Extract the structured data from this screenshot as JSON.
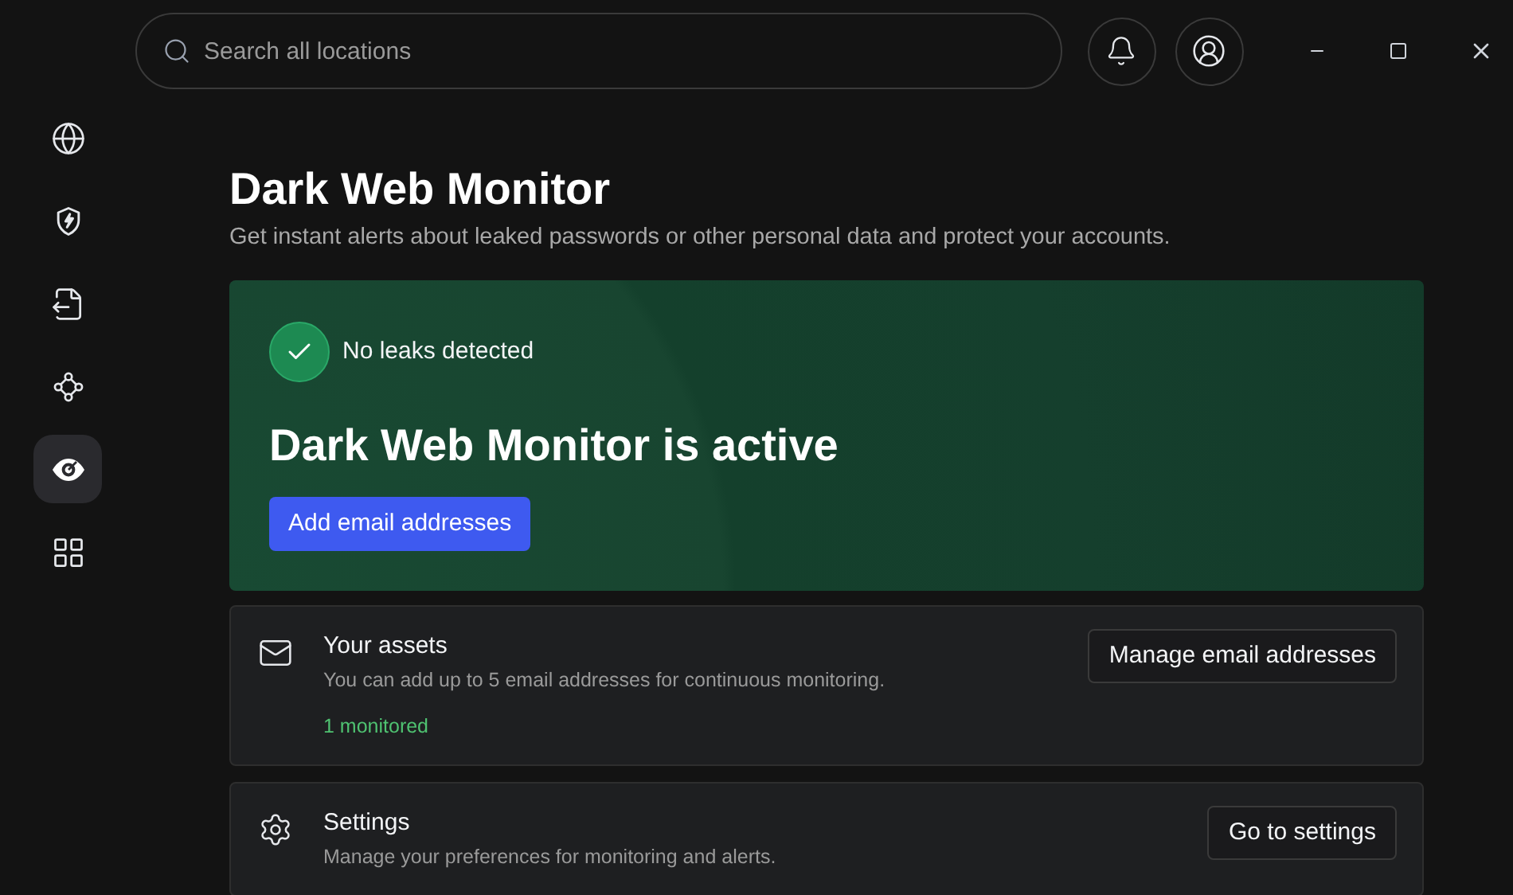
{
  "search": {
    "placeholder": "Search all locations"
  },
  "sidebar": {
    "items": [
      {
        "selected": false
      },
      {
        "selected": false
      },
      {
        "selected": false
      },
      {
        "selected": false
      },
      {
        "selected": true
      },
      {
        "selected": false
      }
    ]
  },
  "page": {
    "title": "Dark Web Monitor",
    "subtitle": "Get instant alerts about leaked passwords or other personal data and protect your accounts."
  },
  "status_card": {
    "status": "No leaks detected",
    "headline": "Dark Web Monitor is active",
    "button": "Add email addresses"
  },
  "sections": [
    {
      "title": "Your assets",
      "description": "You can add up to 5 email addresses for continuous monitoring.",
      "status": "1 monitored",
      "button": "Manage email addresses"
    },
    {
      "title": "Settings",
      "description": "Manage your preferences for monitoring and alerts.",
      "button": "Go to settings"
    }
  ]
}
